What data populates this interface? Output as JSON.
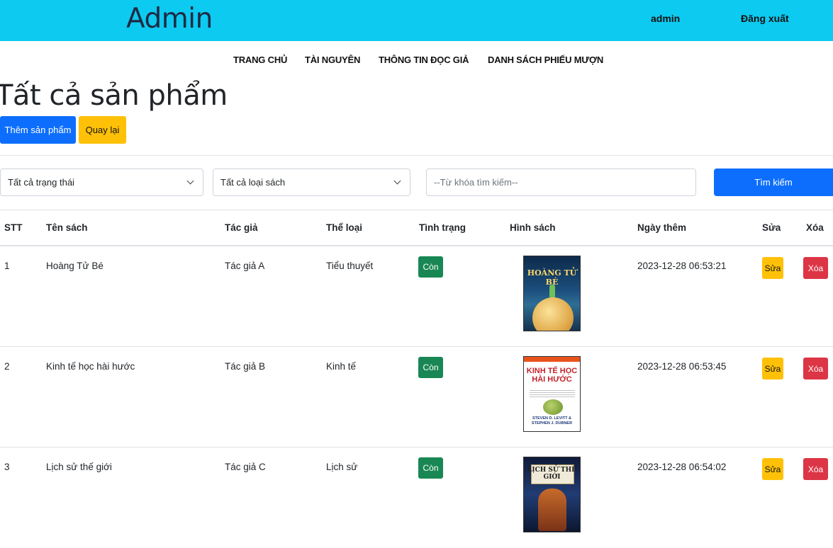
{
  "header": {
    "brand": "Admin",
    "user": "admin",
    "logout": "Đăng xuất"
  },
  "nav": [
    "TRANG CHỦ",
    "TÀI NGUYÊN",
    "THÔNG TIN ĐỌC GIẢ",
    "DANH SÁCH PHIẾU MƯỢN"
  ],
  "page": {
    "title": "Tất cả sản phẩm",
    "add_button": "Thêm sản phẩm",
    "back_button": "Quay lại"
  },
  "filters": {
    "status_selected": "Tất cả trạng thái",
    "category_selected": "Tất cả loại sách",
    "keyword_placeholder": "--Từ khóa tìm kiếm--",
    "search_button": "Tìm kiếm"
  },
  "table": {
    "headers": [
      "STT",
      "Tên sách",
      "Tác giả",
      "Thể loại",
      "Tình trạng",
      "Hình sách",
      "Ngày thêm",
      "Sửa",
      "Xóa"
    ],
    "rows": [
      {
        "stt": "1",
        "name": "Hoàng Tử Bé",
        "author": "Tác giả A",
        "category": "Tiểu thuyết",
        "status": "Còn",
        "cover": "HOÀNG TỬ BÉ",
        "date": "2023-12-28 06:53:21",
        "edit": "Sửa",
        "delete": "Xóa"
      },
      {
        "stt": "2",
        "name": "Kinh tế học hài hước",
        "author": "Tác giả B",
        "category": "Kinh tế",
        "status": "Còn",
        "cover": "KINH TẾ HỌC HÀI HƯỚC",
        "cover_authors": "STEVEN D. LEVITT & STEPHEN J. DUBNER",
        "date": "2023-12-28 06:53:45",
        "edit": "Sửa",
        "delete": "Xóa"
      },
      {
        "stt": "3",
        "name": "Lịch sử thế giới",
        "author": "Tác giả C",
        "category": "Lịch sử",
        "status": "Còn",
        "cover": "LỊCH SỬ THẾ GIỚI",
        "date": "2023-12-28 06:54:02",
        "edit": "Sửa",
        "delete": "Xóa"
      }
    ]
  },
  "colors": {
    "topbar": "#0dcaf0",
    "primary": "#0d6efd",
    "warning": "#ffc107",
    "success": "#198754",
    "danger": "#dc3545"
  }
}
